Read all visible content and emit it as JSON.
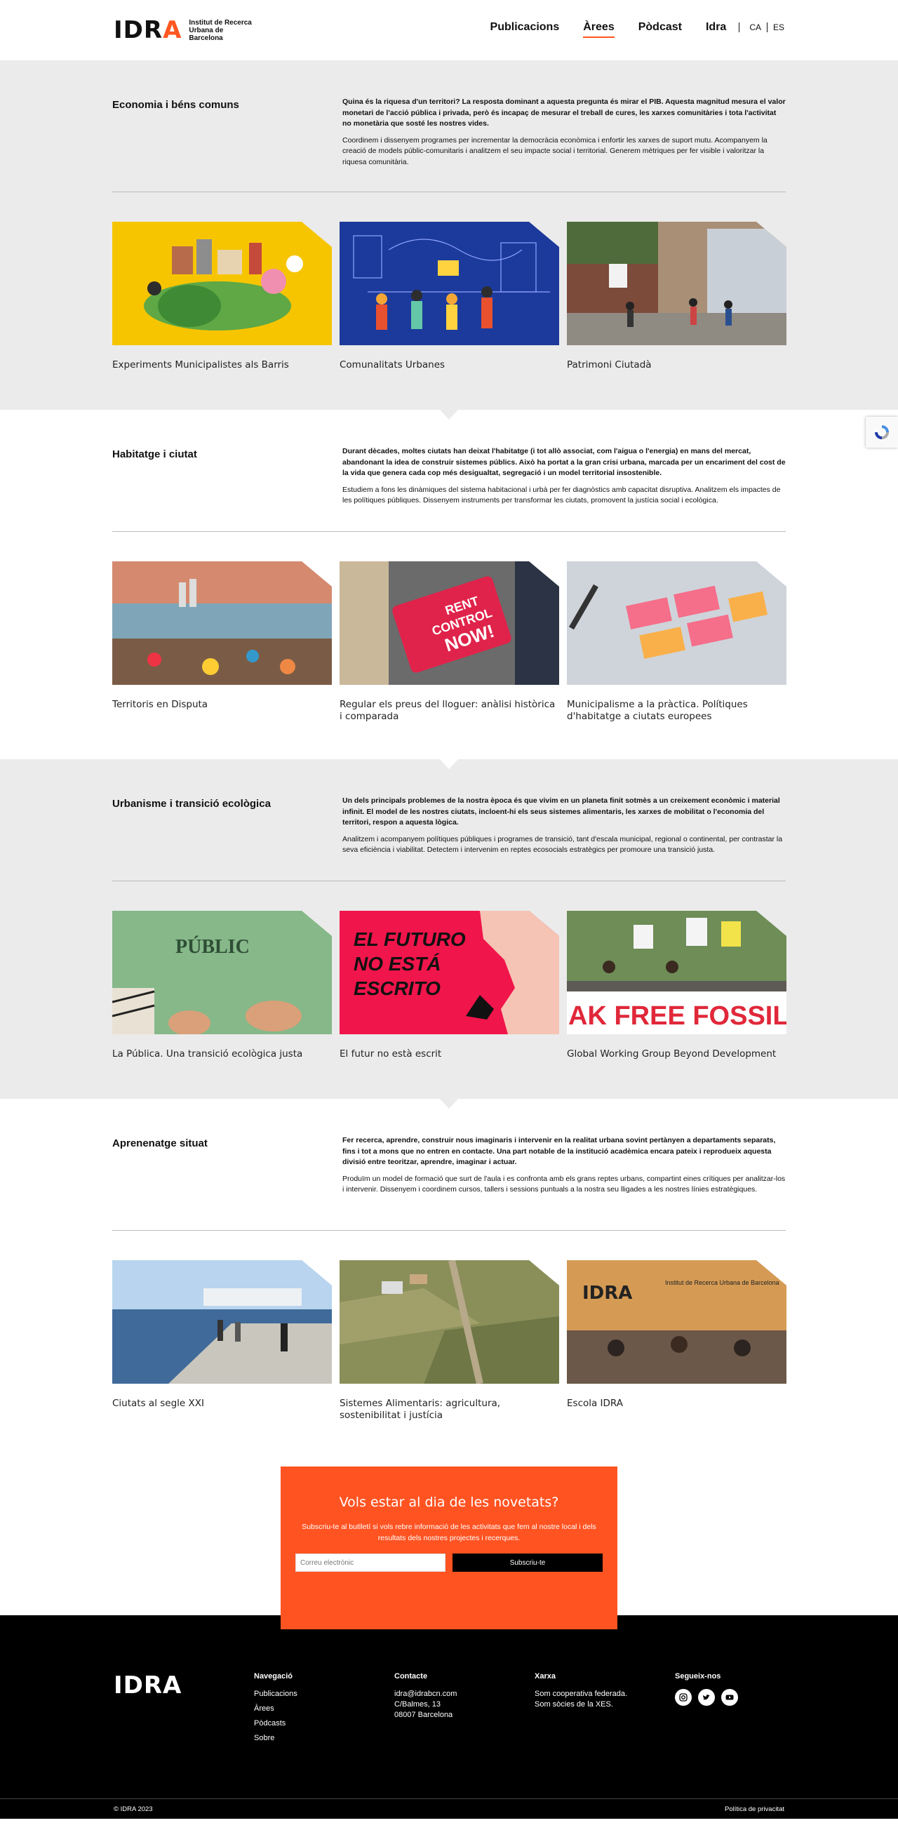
{
  "header": {
    "logo_text": "Institut de Recerca Urbana de Barcelona",
    "nav": [
      "Publicacions",
      "Àrees",
      "Pòdcast",
      "Idra"
    ],
    "lang_ca": "CA",
    "lang_es": "ES"
  },
  "areas": [
    {
      "title": "Economia i béns comuns",
      "lead": "Quina és la riquesa d'un territori? La resposta dominant a aquesta pregunta és mirar el PIB. Aquesta magnitud mesura el valor monetari de l'acció pública i privada, però és incapaç de mesurar el treball de cures, les xarxes comunitàries i tota l'activitat no monetària que sosté les nostres vides.",
      "body": "Coordinem i dissenyem programes per incrementar la democràcia econòmica i enfortir les xarxes de suport mutu. Acompanyem la creació de models públic-comunitaris i analitzem el seu impacte social i territorial. Generem mètriques per fer visible i valoritzar la riquesa comunitària.",
      "cards": [
        "Experiments Municipalistes als Barris",
        "Comunalitats Urbanes",
        "Patrimoni Ciutadà"
      ]
    },
    {
      "title": "Habitatge i ciutat",
      "lead": "Durant dècades, moltes ciutats han deixat l'habitatge (i tot allò associat, com l'aigua o l'energia) en mans del mercat, abandonant la idea de construir sistemes públics. Això ha portat a la gran crisi urbana, marcada per un encariment del cost de la vida que genera cada cop més desigualtat, segregació i un model territorial insostenible.",
      "body": "Estudiem a fons les dinàmiques del sistema habitacional i urbà per fer diagnòstics amb capacitat disruptiva. Analitzem els impactes de les polítiques públiques. Dissenyem instruments per transformar les ciutats, promovent la justícia social i ecològica.",
      "cards": [
        "Territoris en Disputa",
        "Regular els preus del lloguer: anàlisi històrica i comparada",
        "Municipalisme a la pràctica. Polítiques d'habitatge a ciutats europees"
      ]
    },
    {
      "title": "Urbanisme i transició ecològica",
      "lead": "Un dels principals problemes de la nostra època és que vivim en un planeta finit sotmès a un creixement econòmic i material infinit. El model de les nostres ciutats, incloent-hi els seus sistemes alimentaris, les xarxes de mobilitat o l'economia del territori, respon a aquesta lògica.",
      "body": "Analitzem i acompanyem polítiques públiques i programes de transició, tant d'escala municipal, regional o continental, per contrastar la seva eficiència i viabilitat. Detectem i intervenim en reptes ecosocials estratègics per promoure una transició justa.",
      "cards": [
        "La Pública. Una transició ecològica justa",
        "El futur no està escrit",
        "Global Working Group Beyond Development"
      ]
    },
    {
      "title": "Aprenenatge situat",
      "lead": "Fer recerca, aprendre, construir nous imaginaris i intervenir en la realitat urbana sovint pertànyen a departaments separats, fins i tot a mons que no entren en contacte. Una part notable de la institució acadèmica encara pateix i reprodueix aquesta divisió entre teoritzar, aprendre, imaginar i actuar.",
      "body": "Produïm un model de formació que surt de l'aula i es confronta amb els grans reptes urbans, compartint eines crítiques per analitzar-los i intervenir. Dissenyem i coordinem cursos, tallers i sessions puntuals a la nostra seu lligades a les nostres línies estratègiques.",
      "cards": [
        "Ciutats al segle XXI",
        "Sistemes Alimentaris: agricultura, sostenibilitat i justícia",
        "Escola IDRA"
      ]
    }
  ],
  "image_text": {
    "rent1": "RENT",
    "rent2": "CONTROL",
    "rent3": "NOW!",
    "publica": "PÚBLIC",
    "futuro1": "EL FUTURO",
    "futuro2": "NO ESTÁ",
    "futuro3": "ESCRITO",
    "fossil": "AK FREE FOSSIL",
    "sign_idra": "IDRA",
    "sign_line": "Institut de Recerca Urbana de Barcelona"
  },
  "newsletter": {
    "title": "Vols estar al dia de les novetats?",
    "text": "Subscriu-te al butlletí si vols rebre informació de les activitats que fem al nostre local i dels resultats dels nostres projectes i recerques.",
    "placeholder": "Correu electrònic",
    "button": "Subscriu-te"
  },
  "footer": {
    "logo": "IDRA",
    "nav_title": "Navegació",
    "nav_items": [
      "Publicacions",
      "Àrees",
      "Pòdcasts",
      "Sobre"
    ],
    "contact_title": "Contacte",
    "contact_lines": [
      "idra@idrabcn.com",
      "C/Balmes, 13",
      "08007 Barcelona"
    ],
    "network_title": "Xarxa",
    "network_lines": [
      "Som cooperativa federada.",
      "Som sòcies de la XES."
    ],
    "follow_title": "Segueix-nos",
    "copyright": "© IDRA 2023",
    "privacy": "Política de privacitat"
  }
}
